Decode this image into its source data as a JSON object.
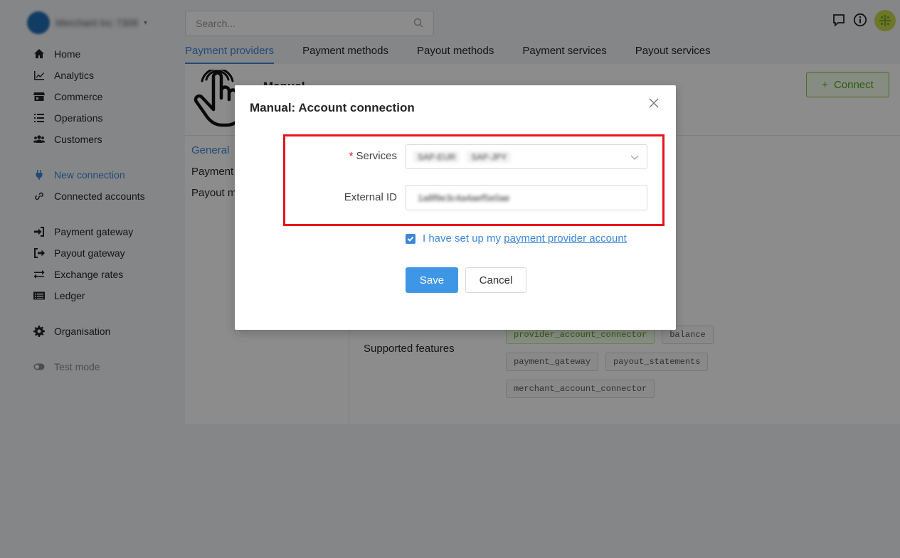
{
  "org": {
    "name": "Merchant Inc 7308"
  },
  "sidebar": {
    "items": [
      {
        "label": "Home",
        "icon": "home-icon"
      },
      {
        "label": "Analytics",
        "icon": "analytics-icon"
      },
      {
        "label": "Commerce",
        "icon": "store-icon"
      },
      {
        "label": "Operations",
        "icon": "list-icon"
      },
      {
        "label": "Customers",
        "icon": "users-icon"
      },
      {
        "label": "New connection",
        "icon": "plug-icon"
      },
      {
        "label": "Connected accounts",
        "icon": "link-icon"
      },
      {
        "label": "Payment gateway",
        "icon": "sign-in-icon"
      },
      {
        "label": "Payout gateway",
        "icon": "sign-out-icon"
      },
      {
        "label": "Exchange rates",
        "icon": "exchange-icon"
      },
      {
        "label": "Ledger",
        "icon": "ledger-icon"
      },
      {
        "label": "Organisation",
        "icon": "gear-icon"
      },
      {
        "label": "Test mode",
        "icon": "toggle-icon"
      }
    ]
  },
  "search": {
    "placeholder": "Search..."
  },
  "tabs": [
    {
      "label": "Payment providers"
    },
    {
      "label": "Payment methods"
    },
    {
      "label": "Payout methods"
    },
    {
      "label": "Payment services"
    },
    {
      "label": "Payout services"
    }
  ],
  "provider": {
    "name": "Manual",
    "connect_label": "Connect",
    "subnav": [
      {
        "label": "General"
      },
      {
        "label": "Payment"
      },
      {
        "label": "Payout m"
      }
    ],
    "features_label": "Supported features",
    "features": [
      "provider_account_connector",
      "balance",
      "payment_gateway",
      "payout_statements",
      "merchant_account_connector"
    ]
  },
  "modal": {
    "title": "Manual: Account connection",
    "services_label": "Services",
    "services_required": "*",
    "services_values": [
      "SAP-EUR",
      "SAP-JPY"
    ],
    "external_id_label": "External ID",
    "external_id_value": "1a8f9e3c4a4aef5e0ae",
    "checkbox_text": "I have set up my",
    "checkbox_link": "payment provider account",
    "save_label": "Save",
    "cancel_label": "Cancel"
  },
  "colors": {
    "accent": "#3d87d9",
    "success": "#52a41a",
    "highlight": "#e8141b"
  }
}
